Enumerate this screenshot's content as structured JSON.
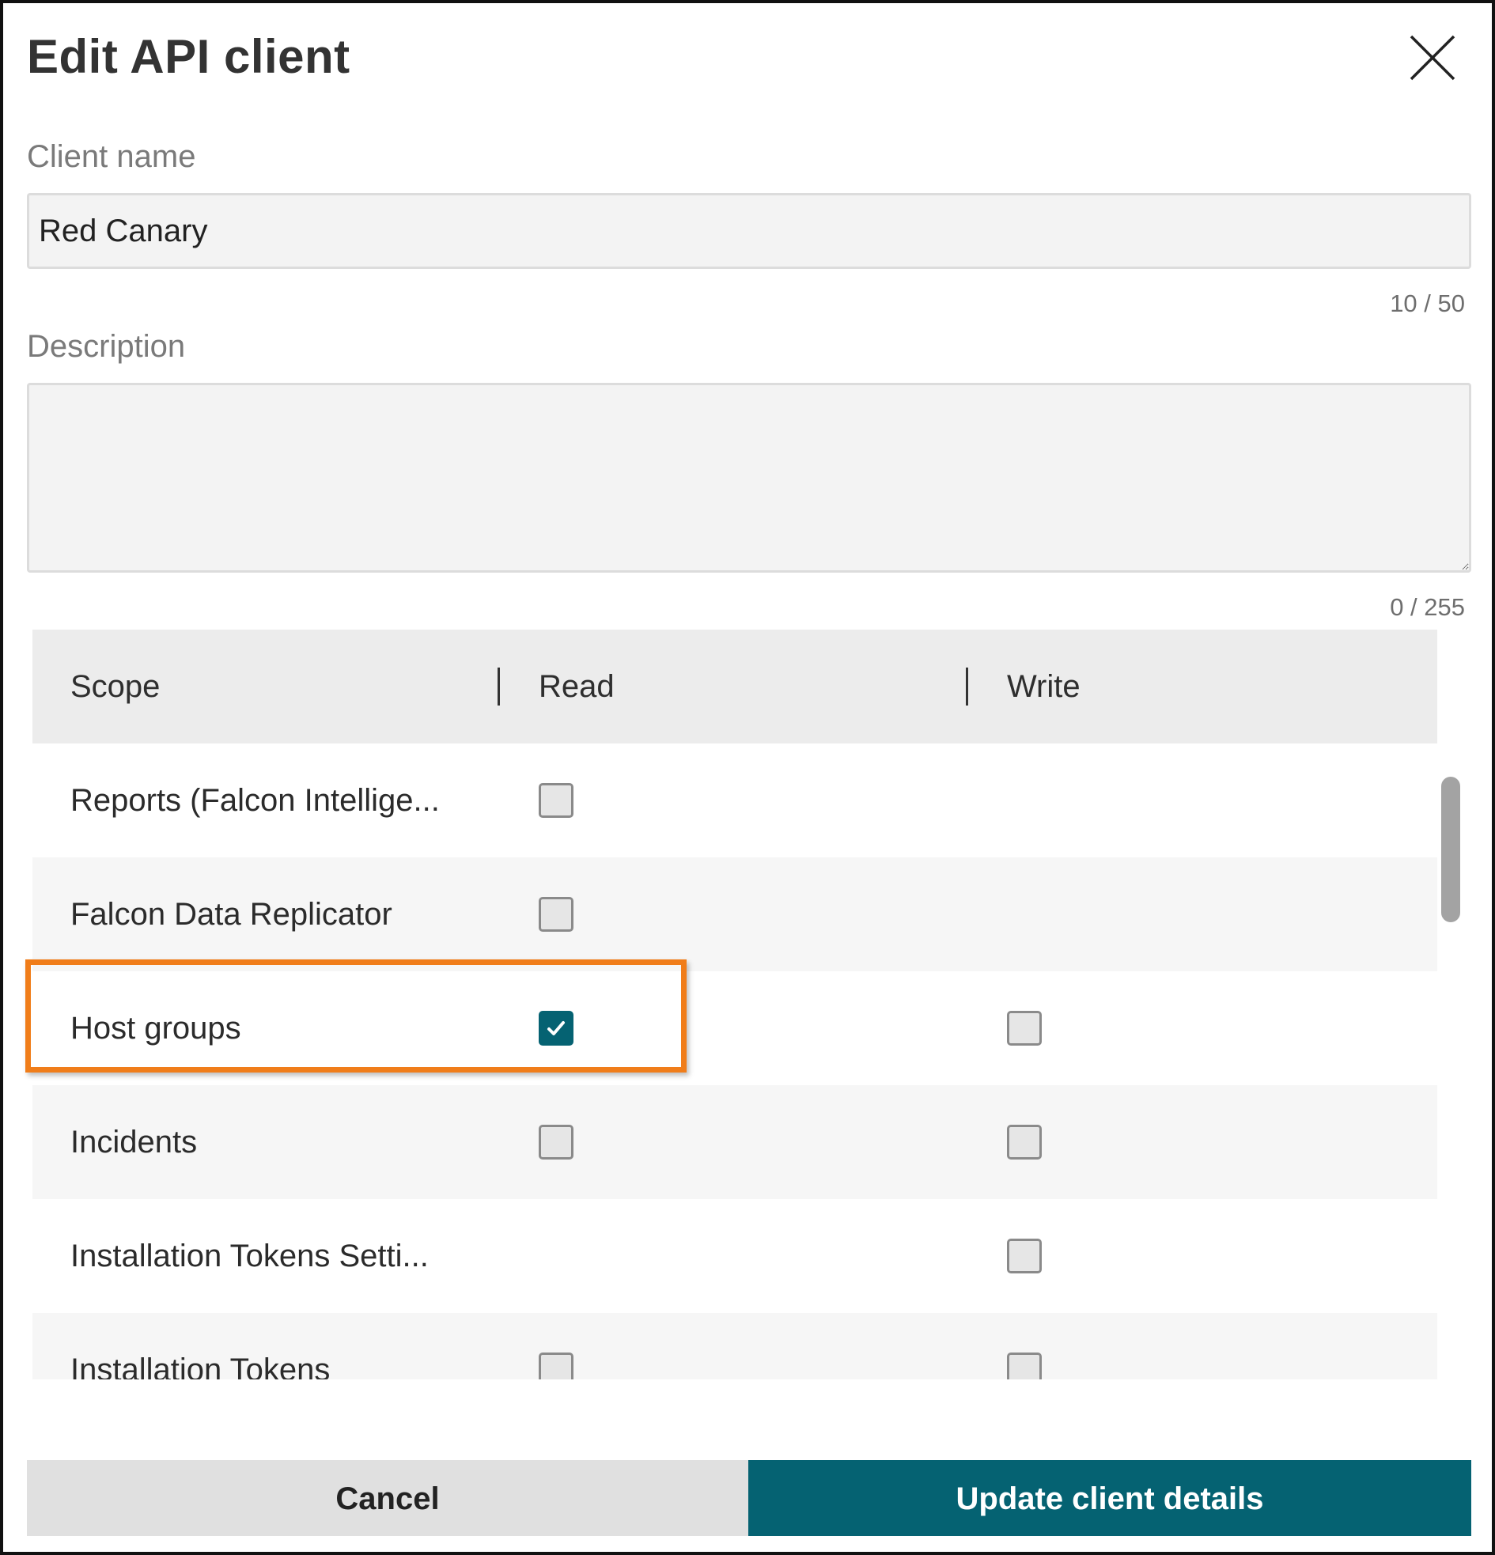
{
  "dialog": {
    "title": "Edit API client",
    "close_icon": "close-icon"
  },
  "client_name": {
    "label": "Client name",
    "value": "Red Canary",
    "counter": "10 / 50"
  },
  "description": {
    "label": "Description",
    "value": "",
    "counter": "0 / 255"
  },
  "scopes_table": {
    "headers": {
      "scope": "Scope",
      "read": "Read",
      "write": "Write"
    },
    "rows": [
      {
        "scope": "Reports (Falcon Intellige...",
        "read": false,
        "write": null
      },
      {
        "scope": "Falcon Data Replicator",
        "read": false,
        "write": null
      },
      {
        "scope": "Host groups",
        "read": true,
        "write": false
      },
      {
        "scope": "Incidents",
        "read": false,
        "write": false
      },
      {
        "scope": "Installation Tokens Setti...",
        "read": null,
        "write": false
      },
      {
        "scope": "Installation Tokens",
        "read": false,
        "write": false
      }
    ]
  },
  "highlight": {
    "color": "#f07d1a",
    "target_row": "Host groups"
  },
  "actions": {
    "cancel_label": "Cancel",
    "update_label": "Update client details"
  },
  "colors": {
    "accent": "#056272",
    "highlight": "#f07d1a"
  }
}
